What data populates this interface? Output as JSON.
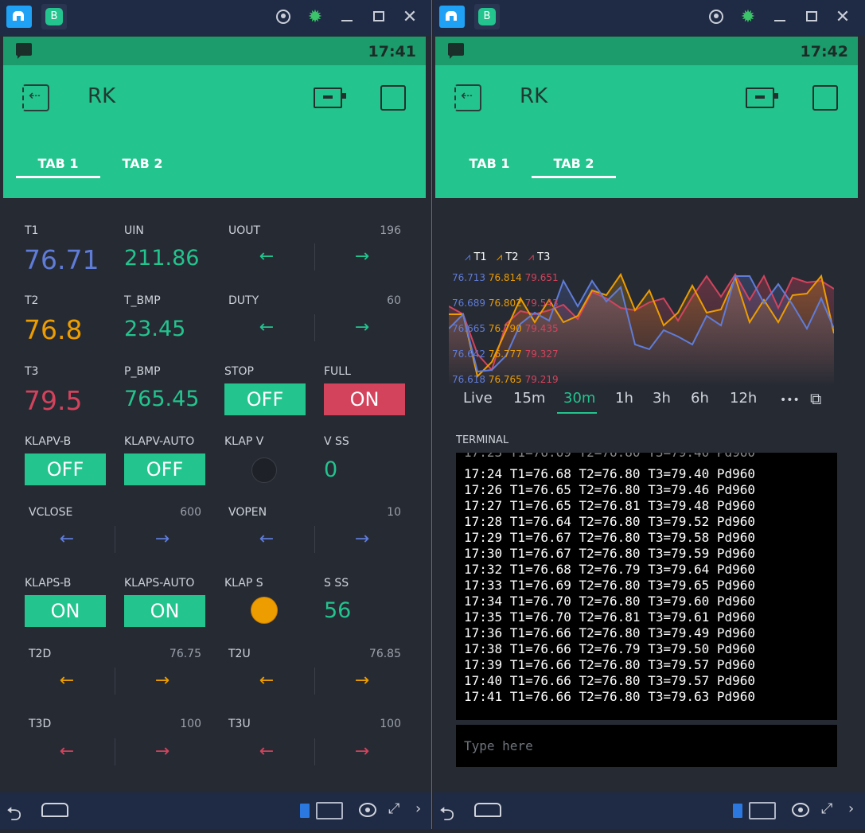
{
  "left": {
    "status_time": "17:41",
    "title": "RK",
    "tabs": [
      "TAB 1",
      "TAB 2"
    ],
    "widgets": {
      "t1": {
        "label": "T1",
        "value": "76.71"
      },
      "uin": {
        "label": "UIN",
        "value": "211.86"
      },
      "uout": {
        "label": "UOUT",
        "value": "196"
      },
      "t2": {
        "label": "T2",
        "value": "76.8"
      },
      "t_bmp": {
        "label": "T_BMP",
        "value": "23.45"
      },
      "duty": {
        "label": "DUTY",
        "value": "60"
      },
      "t3": {
        "label": "T3",
        "value": "79.5"
      },
      "p_bmp": {
        "label": "P_BMP",
        "value": "765.45"
      },
      "stop": {
        "label": "STOP",
        "value": "OFF"
      },
      "full": {
        "label": "FULL",
        "value": "ON"
      },
      "klapv_b": {
        "label": "KLAPV-B",
        "value": "OFF"
      },
      "klapv_auto": {
        "label": "KLAPV-AUTO",
        "value": "OFF"
      },
      "klap_v": {
        "label": "KLAP V"
      },
      "v_ss": {
        "label": "V SS",
        "value": "0"
      },
      "vclose": {
        "label": "VCLOSE",
        "value": "600"
      },
      "vopen": {
        "label": "VOPEN",
        "value": "10"
      },
      "klaps_b": {
        "label": "KLAPS-B",
        "value": "ON"
      },
      "klaps_auto": {
        "label": "KLAPS-AUTO",
        "value": "ON"
      },
      "klap_s": {
        "label": "KLAP S"
      },
      "s_ss": {
        "label": "S SS",
        "value": "56"
      },
      "t2d": {
        "label": "T2D",
        "value": "76.75"
      },
      "t2u": {
        "label": "T2U",
        "value": "76.85"
      },
      "t3d": {
        "label": "T3D",
        "value": "100"
      },
      "t3u": {
        "label": "T3U",
        "value": "100"
      }
    }
  },
  "right": {
    "status_time": "17:42",
    "title": "RK",
    "tabs": [
      "TAB 1",
      "TAB 2"
    ],
    "chart": {
      "legend": [
        "T1",
        "T2",
        "T3"
      ],
      "t1_ticks": [
        "76.713",
        "76.689",
        "76.665",
        "76.642",
        "76.618"
      ],
      "t2_ticks": [
        "76.814",
        "76.802",
        "76.790",
        "76.777",
        "76.765"
      ],
      "t3_ticks": [
        "79.651",
        "79.543",
        "79.435",
        "79.327",
        "79.219"
      ],
      "ranges": [
        "Live",
        "15m",
        "30m",
        "1h",
        "3h",
        "6h",
        "12h"
      ],
      "more": "•••"
    },
    "terminal": {
      "title": "TERMINAL",
      "lines": [
        "17:24 T1=76.68 T2=76.80 T3=79.40 Pd960",
        "17:26 T1=76.65 T2=76.80 T3=79.46 Pd960",
        "17:27 T1=76.65 T2=76.81 T3=79.48 Pd960",
        "17:28 T1=76.64 T2=76.80 T3=79.52 Pd960",
        "17:29 T1=76.67 T2=76.80 T3=79.58 Pd960",
        "17:30 T1=76.67 T2=76.80 T3=79.59 Pd960",
        "17:32 T1=76.68 T2=76.79 T3=79.64 Pd960",
        "17:33 T1=76.69 T2=76.80 T3=79.65 Pd960",
        "17:34 T1=76.70 T2=76.80 T3=79.60 Pd960",
        "17:35 T1=76.70 T2=76.81 T3=79.61 Pd960",
        "17:36 T1=76.66 T2=76.80 T3=79.49 Pd960",
        "17:38 T1=76.66 T2=76.79 T3=79.50 Pd960",
        "17:39 T1=76.66 T2=76.80 T3=79.57 Pd960",
        "17:40 T1=76.66 T2=76.80 T3=79.57 Pd960",
        "17:41 T1=76.66 T2=76.80 T3=79.63 Pd960"
      ],
      "placeholder": "Type here"
    }
  },
  "colors": {
    "green": "#23c48e",
    "red": "#d3435c",
    "blue": "#5f7cd8",
    "orange": "#ed9d00",
    "teal": "#23c48e"
  }
}
